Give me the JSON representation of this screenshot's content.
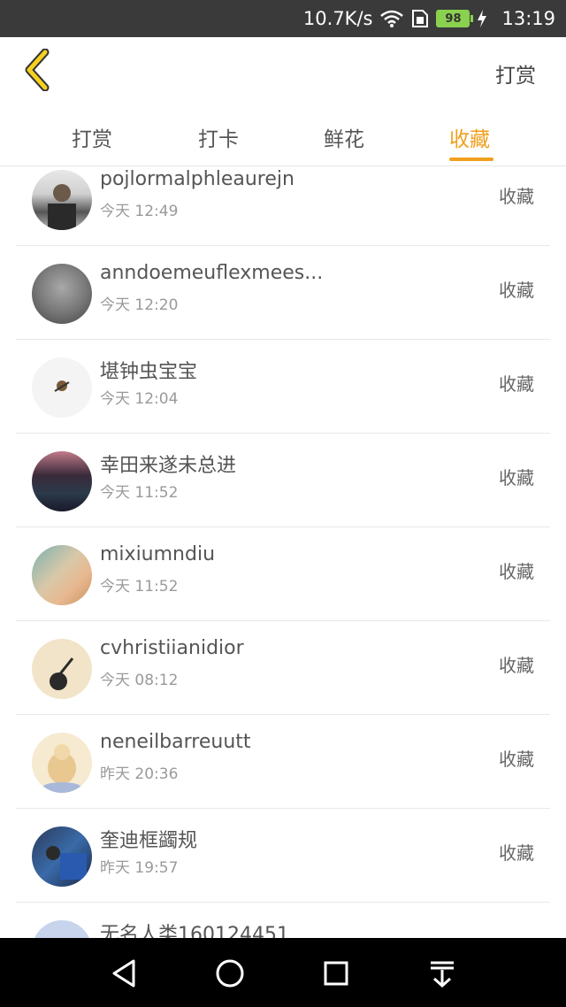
{
  "status_bar": {
    "network_speed": "10.7K/s",
    "battery_level": "98",
    "time": "13:19",
    "icons": [
      "wifi-icon",
      "sim-icon",
      "battery-icon",
      "charging-icon"
    ]
  },
  "header": {
    "back_icon": "chevron-left-icon",
    "action_label": "打赏"
  },
  "tabs": [
    {
      "label": "打赏",
      "active": false
    },
    {
      "label": "打卡",
      "active": false
    },
    {
      "label": "鲜花",
      "active": false
    },
    {
      "label": "收藏",
      "active": true
    }
  ],
  "accent_color": "#f0a01e",
  "list": {
    "items": [
      {
        "name": "pojlormalphleaurejn",
        "time": "今天 12:49",
        "action": "收藏"
      },
      {
        "name": "anndoemeuflexmees...",
        "time": "今天 12:20",
        "action": "收藏"
      },
      {
        "name": "堪钟虫宝宝",
        "time": "今天 12:04",
        "action": "收藏"
      },
      {
        "name": "幸田来遂未总进",
        "time": "今天 11:52",
        "action": "收藏"
      },
      {
        "name": "mixiumndiu",
        "time": "今天 11:52",
        "action": "收藏"
      },
      {
        "name": "cvhristiianidior",
        "time": "今天 08:12",
        "action": "收藏"
      },
      {
        "name": "neneilbarreuutt",
        "time": "昨天 20:36",
        "action": "收藏"
      },
      {
        "name": "奎迪框蠲规",
        "time": "昨天 19:57",
        "action": "收藏"
      },
      {
        "name": "无名人类160124451",
        "time": "",
        "action": ""
      }
    ]
  },
  "nav_bar": {
    "icons": [
      "back-triangle-icon",
      "home-circle-icon",
      "recents-square-icon",
      "notification-pull-icon"
    ]
  }
}
